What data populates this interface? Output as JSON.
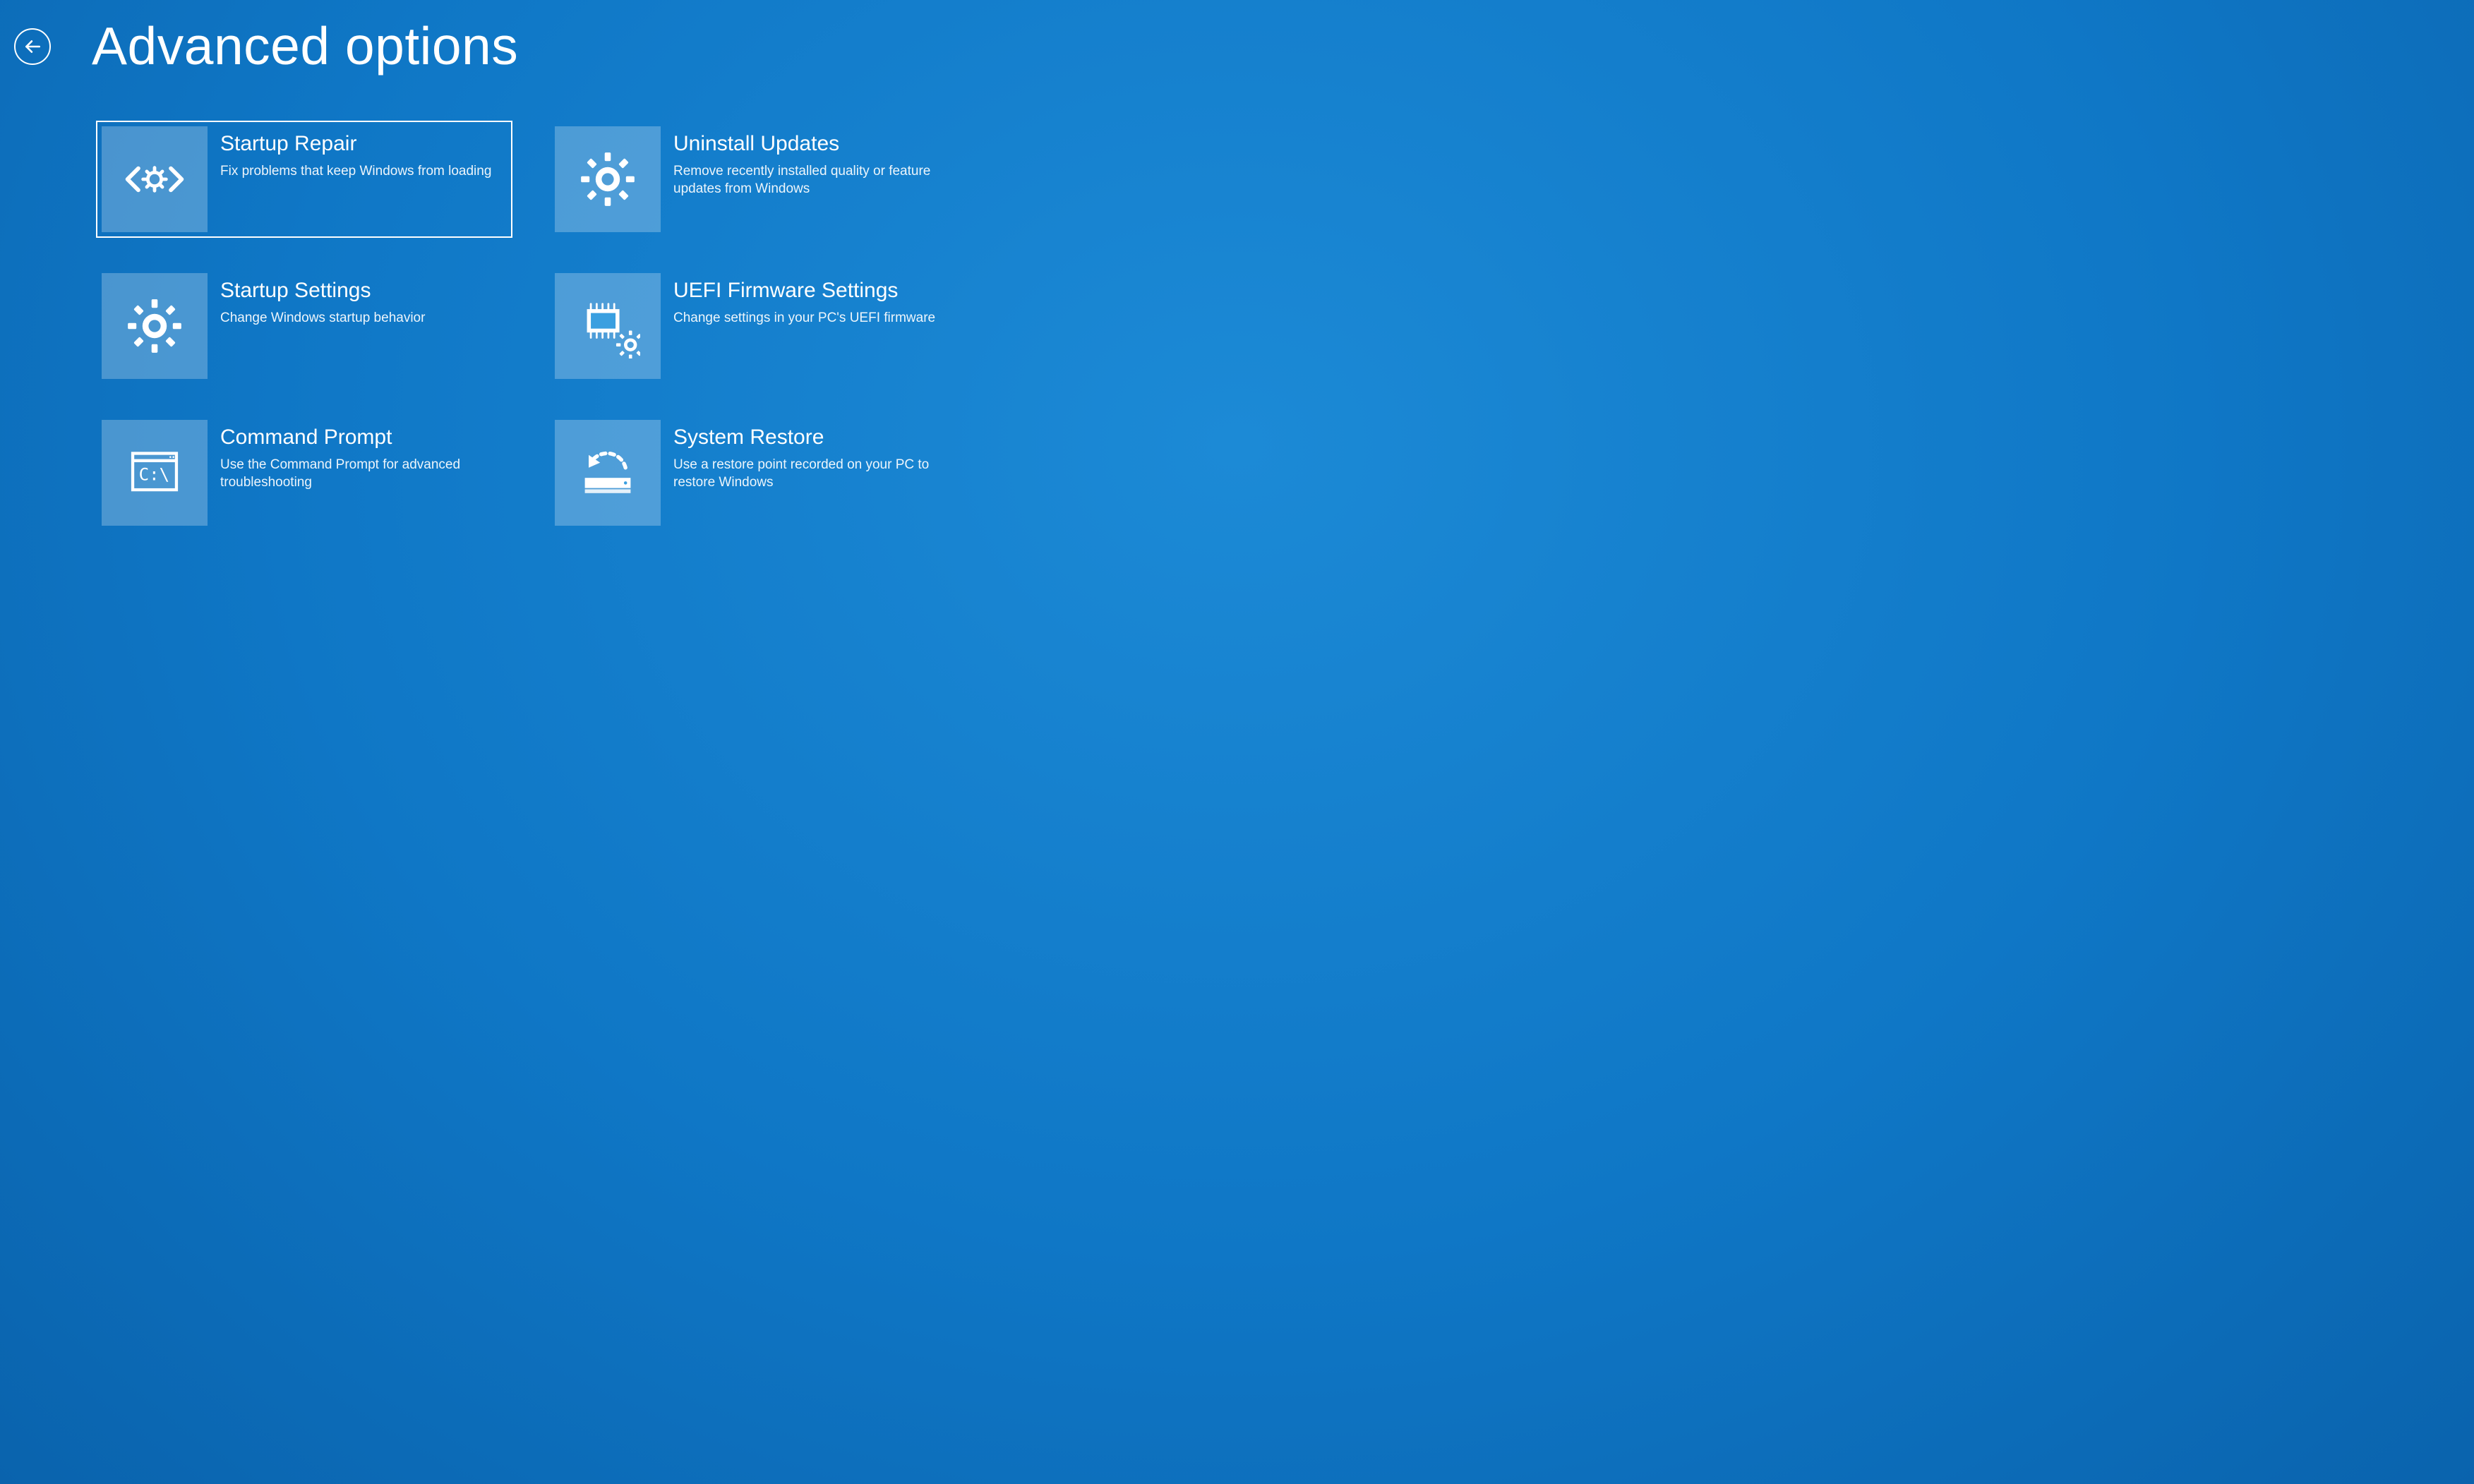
{
  "page_title": "Advanced options",
  "tiles": [
    {
      "id": "startup-repair",
      "title": "Startup Repair",
      "desc": "Fix problems that keep Windows from loading",
      "selected": true
    },
    {
      "id": "uninstall-updates",
      "title": "Uninstall Updates",
      "desc": "Remove recently installed quality or feature updates from Windows",
      "selected": false
    },
    {
      "id": "startup-settings",
      "title": "Startup Settings",
      "desc": "Change Windows startup behavior",
      "selected": false
    },
    {
      "id": "uefi-firmware",
      "title": "UEFI Firmware Settings",
      "desc": "Change settings in your PC's UEFI firmware",
      "selected": false
    },
    {
      "id": "command-prompt",
      "title": "Command Prompt",
      "desc": "Use the Command Prompt for advanced troubleshooting",
      "selected": false
    },
    {
      "id": "system-restore",
      "title": "System Restore",
      "desc": "Use a restore point recorded on your PC to restore Windows",
      "selected": false
    }
  ]
}
